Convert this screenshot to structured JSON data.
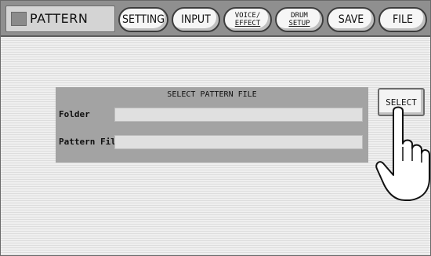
{
  "header": {
    "title": "PATTERN",
    "tabs": [
      {
        "label": "SETTING"
      },
      {
        "label": "INPUT"
      },
      {
        "line1": "VOICE/",
        "line2": "EFFECT"
      },
      {
        "line1": "DRUM",
        "line2": "SETUP"
      },
      {
        "label": "SAVE"
      },
      {
        "label": "FILE"
      }
    ]
  },
  "panel": {
    "title": "SELECT PATTERN FILE",
    "fields": [
      {
        "label": "Folder",
        "value": ""
      },
      {
        "label": "Pattern File",
        "value": ""
      }
    ]
  },
  "select_button": {
    "label": "SELECT"
  },
  "icons": {
    "pointer": "pointing-hand-icon"
  }
}
